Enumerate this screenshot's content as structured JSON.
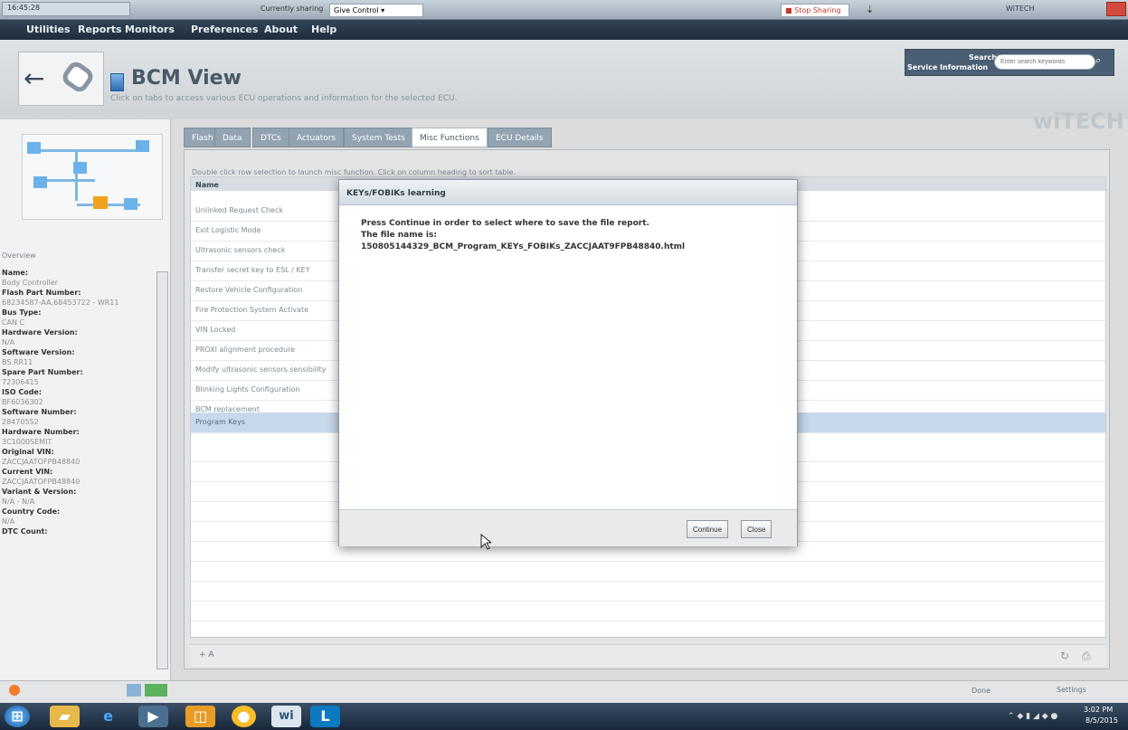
{
  "topbar": {
    "clock_label": "16:45:28",
    "sharing_status": "Currently sharing",
    "give_control": "Give Control ▾",
    "stop_sharing": "Stop Sharing",
    "right_title": "WiTECH"
  },
  "menu": [
    "Utilities",
    "Reports",
    "Monitors",
    "Preferences",
    "About",
    "Help"
  ],
  "header": {
    "title": "BCM View",
    "subtitle": "Click on tabs to access various ECU operations and information for the selected ECU.",
    "search_label": "Search",
    "search_scope": "Service Information",
    "search_placeholder": "Enter search keywords",
    "brand": "wiTECH"
  },
  "left_panel": {
    "overview": "Overview",
    "details": [
      {
        "label": "Name:",
        "value": "Body Controller"
      },
      {
        "label": "Flash Part Number:",
        "value": "68234587-AA,68453722 - WR11"
      },
      {
        "label": "Bus Type:",
        "value": "CAN C"
      },
      {
        "label": "Hardware Version:",
        "value": "N/A"
      },
      {
        "label": "Software Version:",
        "value": "BS.RR11"
      },
      {
        "label": "Spare Part Number:",
        "value": "72306415"
      },
      {
        "label": "ISO Code:",
        "value": "BF6036302"
      },
      {
        "label": "Software Number:",
        "value": "28470552"
      },
      {
        "label": "Hardware Number:",
        "value": "3C1000SEMIT"
      },
      {
        "label": "Original VIN:",
        "value": "ZACCJAATOFPB48840"
      },
      {
        "label": "Current VIN:",
        "value": "ZACCJAATOFPB48840"
      },
      {
        "label": "Variant & Version:",
        "value": "N/A - N/A"
      },
      {
        "label": "Country Code:",
        "value": "N/A"
      },
      {
        "label": "DTC Count:",
        "value": ""
      }
    ]
  },
  "tabs": [
    "Flash",
    "Data",
    "DTCs",
    "Actuators",
    "System Tests",
    "Misc Functions",
    "ECU Details"
  ],
  "misc": {
    "instruction": "Double click row selection to launch misc function. Click on column heading to sort table.",
    "table_header": "Name",
    "rows": [
      "Unlinked Request Check",
      "Exit Logistic Mode",
      "Ultrasonic sensors check",
      "Transfer secret key to ESL / KEY",
      "Restore Vehicle Configuration",
      "Fire Protection System Activate",
      "VIN Locked",
      "PROXI alignment procedure",
      "Modify ultrasonic sensors sensibility",
      "Blinking Lights Configuration",
      "BCM replacement",
      "Program Keys"
    ]
  },
  "dialog": {
    "title": "KEYs/FOBIKs learning",
    "message": "Press Continue in order to select where to save the file report.",
    "file_line": "The file name is:",
    "file_name": "150805144329_BCM_Program_KEYs_FOBIKs_ZACCJAAT9FPB48840.html",
    "continue_button": "Continue",
    "close_button": "Close"
  },
  "footer": {
    "status_left": "Done",
    "status_right": "Settings",
    "date": "8/5/2015",
    "time": "3:02 PM"
  }
}
